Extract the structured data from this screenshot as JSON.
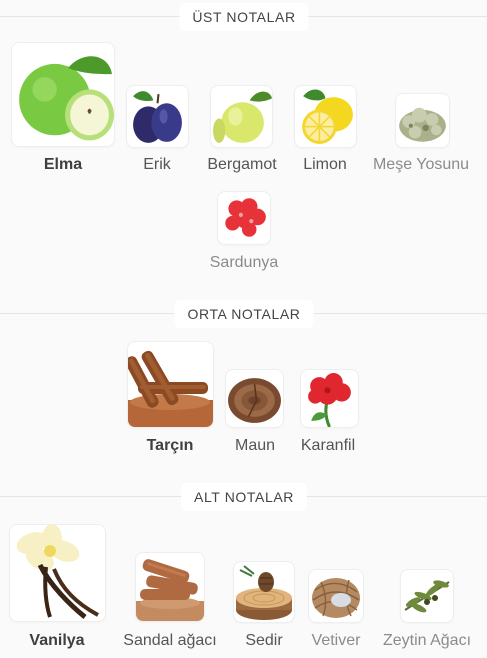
{
  "sections": {
    "top": {
      "heading": "ÜST NOTALAR",
      "notes": [
        "Elma",
        "Erik",
        "Bergamot",
        "Limon",
        "Meşe Yosunu",
        "Sardunya"
      ]
    },
    "middle": {
      "heading": "ORTA NOTALAR",
      "notes": [
        "Tarçın",
        "Maun",
        "Karanfil"
      ]
    },
    "base": {
      "heading": "ALT NOTALAR",
      "notes": [
        "Vanilya",
        "Sandal ağacı",
        "Sedir",
        "Vetiver",
        "Zeytin Ağacı"
      ]
    }
  },
  "icons": {
    "top": [
      "apple-icon",
      "plum-icon",
      "bergamot-icon",
      "lemon-icon",
      "oakmoss-icon",
      "geranium-icon"
    ],
    "middle": [
      "cinnamon-icon",
      "mahogany-icon",
      "carnation-icon"
    ],
    "base": [
      "vanilla-icon",
      "sandalwood-icon",
      "cedar-icon",
      "vetiver-icon",
      "olive-tree-icon"
    ]
  },
  "colors": {
    "emphasis_strong": "#3f3f3f",
    "emphasis_medium": "#555555",
    "emphasis_weak": "#8b8b8b",
    "divider": "#e4e4e4"
  }
}
